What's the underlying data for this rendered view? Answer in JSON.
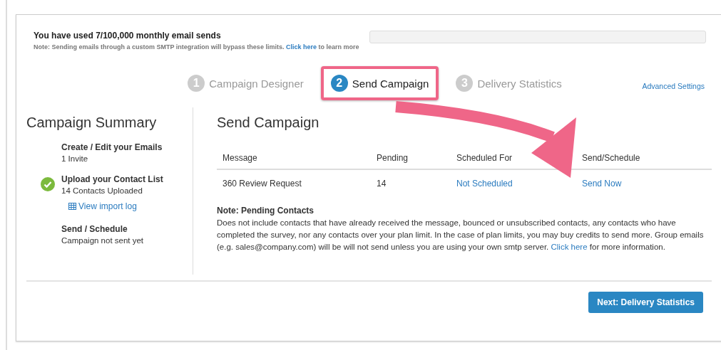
{
  "usage": {
    "title": "You have used 7/100,000 monthly email sends",
    "note": "Note: Sending emails through a custom SMTP integration will bypass these limits.",
    "note_link": "Click here",
    "note_after": "to learn more",
    "level": 7e-05
  },
  "steps": [
    {
      "number": "1",
      "label": "Campaign Designer",
      "selected": false
    },
    {
      "number": "2",
      "label": "Send Campaign",
      "selected": true
    },
    {
      "number": "3",
      "label": "Delivery Statistics",
      "selected": false
    }
  ],
  "advanced_settings": "Advanced Settings",
  "summary": {
    "title": "Campaign Summary",
    "items": [
      {
        "title": "Create / Edit your Emails",
        "detail": "1 Invite",
        "done": false
      },
      {
        "title": "Upload your Contact List",
        "detail": "14 Contacts Uploaded",
        "done": true,
        "link": "View import log"
      },
      {
        "title": "Send / Schedule",
        "detail": "Campaign not sent yet",
        "done": false
      }
    ]
  },
  "send": {
    "title": "Send Campaign",
    "columns": [
      "Message",
      "Pending",
      "Scheduled For",
      "Send/Schedule"
    ],
    "rows": [
      {
        "message": "360 Review Request",
        "pending": "14",
        "scheduled": "Not Scheduled",
        "action": "Send Now"
      }
    ],
    "note_title": "Note: Pending Contacts",
    "note": "Does not include contacts that have already received the message, bounced or unsubscribed contacts, any contacts who have completed the survey, nor any contacts over your plan limit. In the case of plan limits, you may buy credits to send more. Group emails (e.g. sales@company.com) will be will not send unless you are using your own smtp server.",
    "note_link": "Click here",
    "note_after": "for more information."
  },
  "next_button": "Next: Delivery Statistics"
}
